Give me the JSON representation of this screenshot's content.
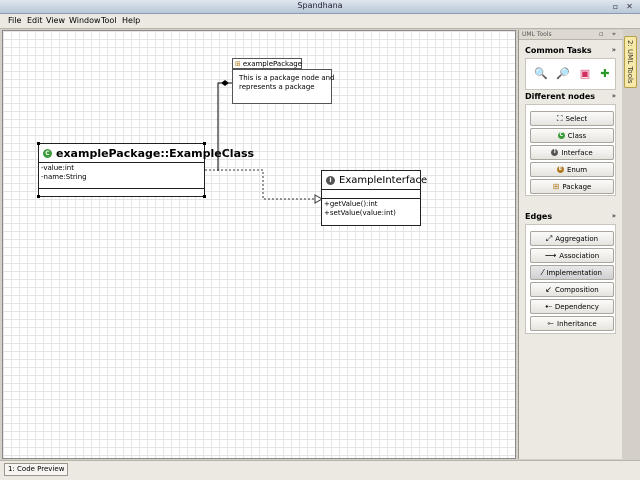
{
  "window": {
    "title": "Spandhana"
  },
  "menu": [
    "File",
    "Edit",
    "View",
    "Window",
    "Tool",
    "Help"
  ],
  "diagram": {
    "package": {
      "name": "examplePackage",
      "note": [
        "This is a package node and",
        "represents a package"
      ]
    },
    "class": {
      "name": "examplePackage::ExampleClass",
      "attributes": [
        "-value:int",
        "-name:String"
      ]
    },
    "interface": {
      "name": "ExampleInterface",
      "methods": [
        "+getValue():int",
        "+setValue(value:int)"
      ]
    }
  },
  "panel": {
    "header": "UML Tools",
    "common_tasks": {
      "title": "Common Tasks",
      "chevron": "»"
    },
    "nodes": {
      "title": "Different nodes",
      "chevron": "»",
      "buttons": [
        "Select",
        "Class",
        "Interface",
        "Enum",
        "Package"
      ]
    },
    "edges": {
      "title": "Edges",
      "chevron": "»",
      "buttons": [
        "Aggregation",
        "Association",
        "Implementation",
        "Composition",
        "Dependency",
        "Inheritance"
      ]
    }
  },
  "side_tab": {
    "label": "2: UML Tools"
  },
  "status": {
    "code_preview": "1: Code Preview"
  },
  "colors": {
    "class_badge": "#3a9a3a",
    "interface_badge": "#555555",
    "enum_badge": "#b07a20",
    "side_tab": "#f7e9a8"
  }
}
